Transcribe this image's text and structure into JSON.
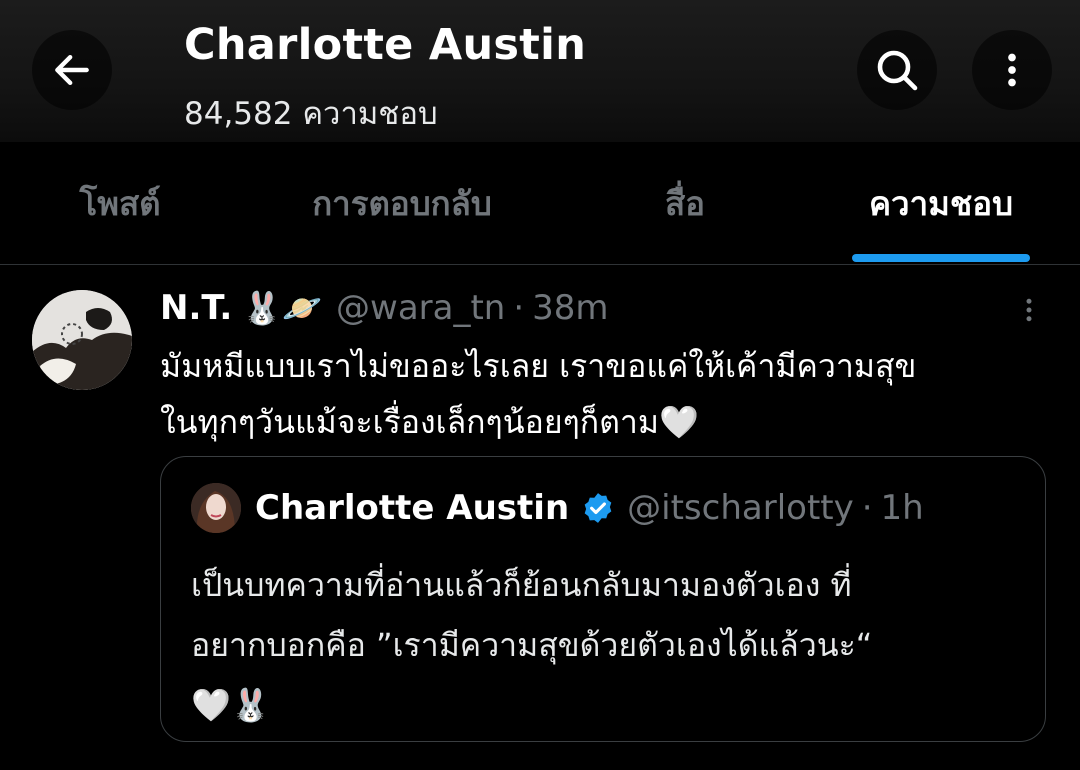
{
  "header": {
    "title": "Charlotte Austin",
    "subtitle": "84,582 ความชอบ",
    "back_icon": "arrow-left-icon",
    "search_icon": "search-icon",
    "more_icon": "more-vertical-icon"
  },
  "tabs": [
    {
      "label": "โพสต์",
      "active": false
    },
    {
      "label": "การตอบกลับ",
      "active": false
    },
    {
      "label": "สื่อ",
      "active": false
    },
    {
      "label": "ความชอบ",
      "active": true
    }
  ],
  "colors": {
    "accent": "#1d9bf0",
    "background": "#000000",
    "muted_text": "#71767b"
  },
  "post": {
    "name": "N.T.",
    "emoji": "🐰🪐",
    "handle": "@wara_tn",
    "separator": "·",
    "time": "38m",
    "text": "มัมหมีแบบเราไม่ขออะไรเลย เราขอแค่ให้เค้ามีความสุข\nในทุกๆวันแม้จะเรื่องเล็กๆน้อยๆก็ตาม🤍",
    "more_icon": "more-vertical-icon"
  },
  "quote": {
    "name": "Charlotte Austin",
    "verified_icon": "verified-badge-icon",
    "handle": "@itscharlotty",
    "separator": "·",
    "time": "1h",
    "text": "เป็นบทความที่อ่านแล้วก็ย้อนกลับมามองตัวเอง ที่\nอยากบอกคือ ”เรามีความสุขด้วยตัวเองได้แล้วนะ“\n🤍🐰"
  }
}
